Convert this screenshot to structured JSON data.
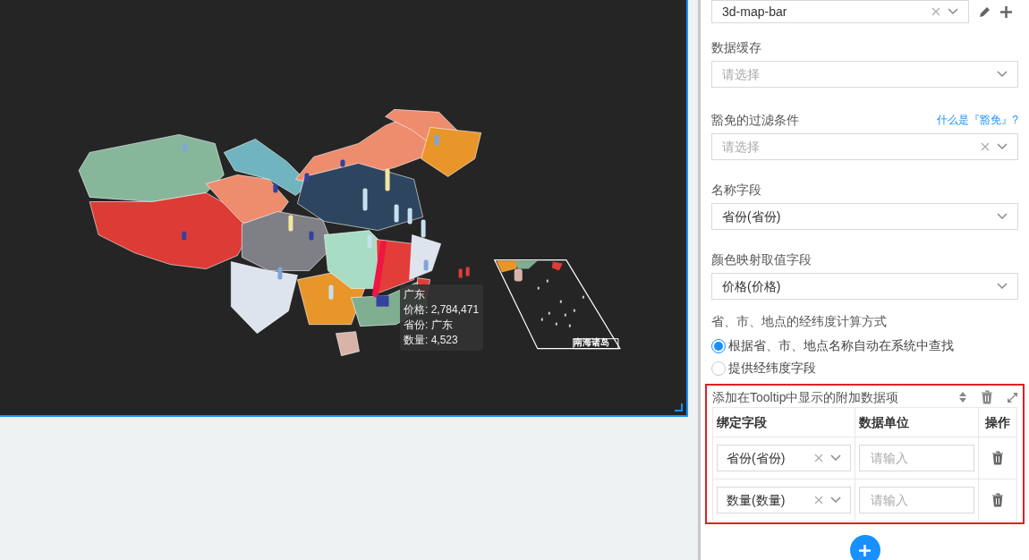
{
  "chart_panel": {
    "inset_label": "南海诸岛",
    "tooltip": {
      "title": "广东",
      "lines": [
        "价格: 2,784,471",
        "省份: 广东",
        "数量: 4,523"
      ]
    }
  },
  "settings": {
    "dataset_select": {
      "value": "3d-map-bar",
      "clearable": true
    },
    "fields": [
      {
        "label": "数据缓存",
        "placeholder": "请选择",
        "clearable": false
      },
      {
        "label": "豁免的过滤条件",
        "link": "什么是『豁免』?",
        "placeholder": "请选择",
        "clearable": true
      },
      {
        "label": "名称字段",
        "value": "省份(省份)",
        "clearable": false
      },
      {
        "label": "颜色映射取值字段",
        "value": "价格(价格)",
        "clearable": false
      }
    ],
    "coord_method": {
      "label": "省、市、地点的经纬度计算方式",
      "options": [
        {
          "label": "根据省、市、地点名称自动在系统中查找",
          "selected": true
        },
        {
          "label": "提供经纬度字段",
          "selected": false
        }
      ]
    },
    "tooltip_items": {
      "title": "添加在Tooltip中显示的附加数据项",
      "columns": [
        "绑定字段",
        "数据单位",
        "操作"
      ],
      "rows": [
        {
          "field": "省份(省份)",
          "unit_placeholder": "请输入"
        },
        {
          "field": "数量(数量)",
          "unit_placeholder": "请输入"
        }
      ]
    }
  }
}
